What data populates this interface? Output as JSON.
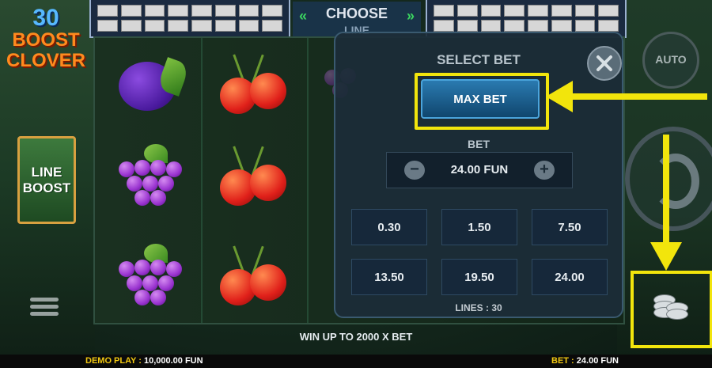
{
  "logo": {
    "line1": "30",
    "line2": "BOOST",
    "line3": "CLOVER"
  },
  "line_boost": {
    "line1": "LINE",
    "line2": "BOOST"
  },
  "choose_line": {
    "title": "CHOOSE",
    "subtitle": "LINE",
    "chevron_left": "«",
    "chevron_right": "»"
  },
  "bet_panel": {
    "title": "SELECT BET",
    "max_bet_label": "MAX BET",
    "bet_label": "BET",
    "bet_value": "24.00 FUN",
    "minus": "−",
    "plus": "+",
    "options": [
      "0.30",
      "1.50",
      "7.50",
      "13.50",
      "19.50",
      "24.00"
    ],
    "lines": "LINES : 30"
  },
  "auto_button": {
    "label": "AUTO"
  },
  "win_text": "WIN UP TO 2000 X BET",
  "footer": {
    "demo_label": "DEMO PLAY :",
    "demo_value": "10,000.00 FUN",
    "bet_label": "BET :",
    "bet_value": "24.00 FUN"
  },
  "icons": [
    "close-icon",
    "auto-icon",
    "spin-icon",
    "coins-icon",
    "menu-icon"
  ],
  "colors": {
    "highlight": "#f2e50c",
    "accent_green": "#3bd660",
    "footer_gold": "#f2c811"
  }
}
